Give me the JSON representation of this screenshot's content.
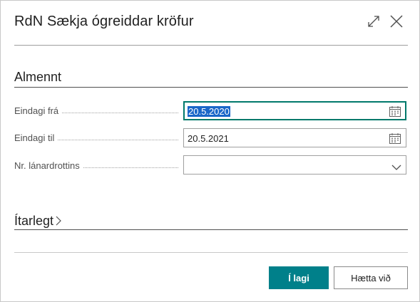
{
  "dialog": {
    "title": "RdN Sækja ógreiddar kröfur",
    "expand_icon": "expand-icon",
    "close_icon": "close-icon"
  },
  "sections": {
    "general": {
      "title": "Almennt"
    },
    "details": {
      "title": "Ítarlegt",
      "chevron": "›"
    }
  },
  "fields": [
    {
      "label": "Eindagi frá",
      "value": "20.5.2020",
      "type": "date",
      "selected": true
    },
    {
      "label": "Eindagi til",
      "value": "20.5.2021",
      "type": "date"
    },
    {
      "label": "Nr. lánardrottins",
      "value": "",
      "type": "dropdown"
    }
  ],
  "buttons": {
    "ok": "Í lagi",
    "cancel": "Hætta við"
  },
  "colors": {
    "primary": "#00808a",
    "selection": "#1a66c8"
  }
}
